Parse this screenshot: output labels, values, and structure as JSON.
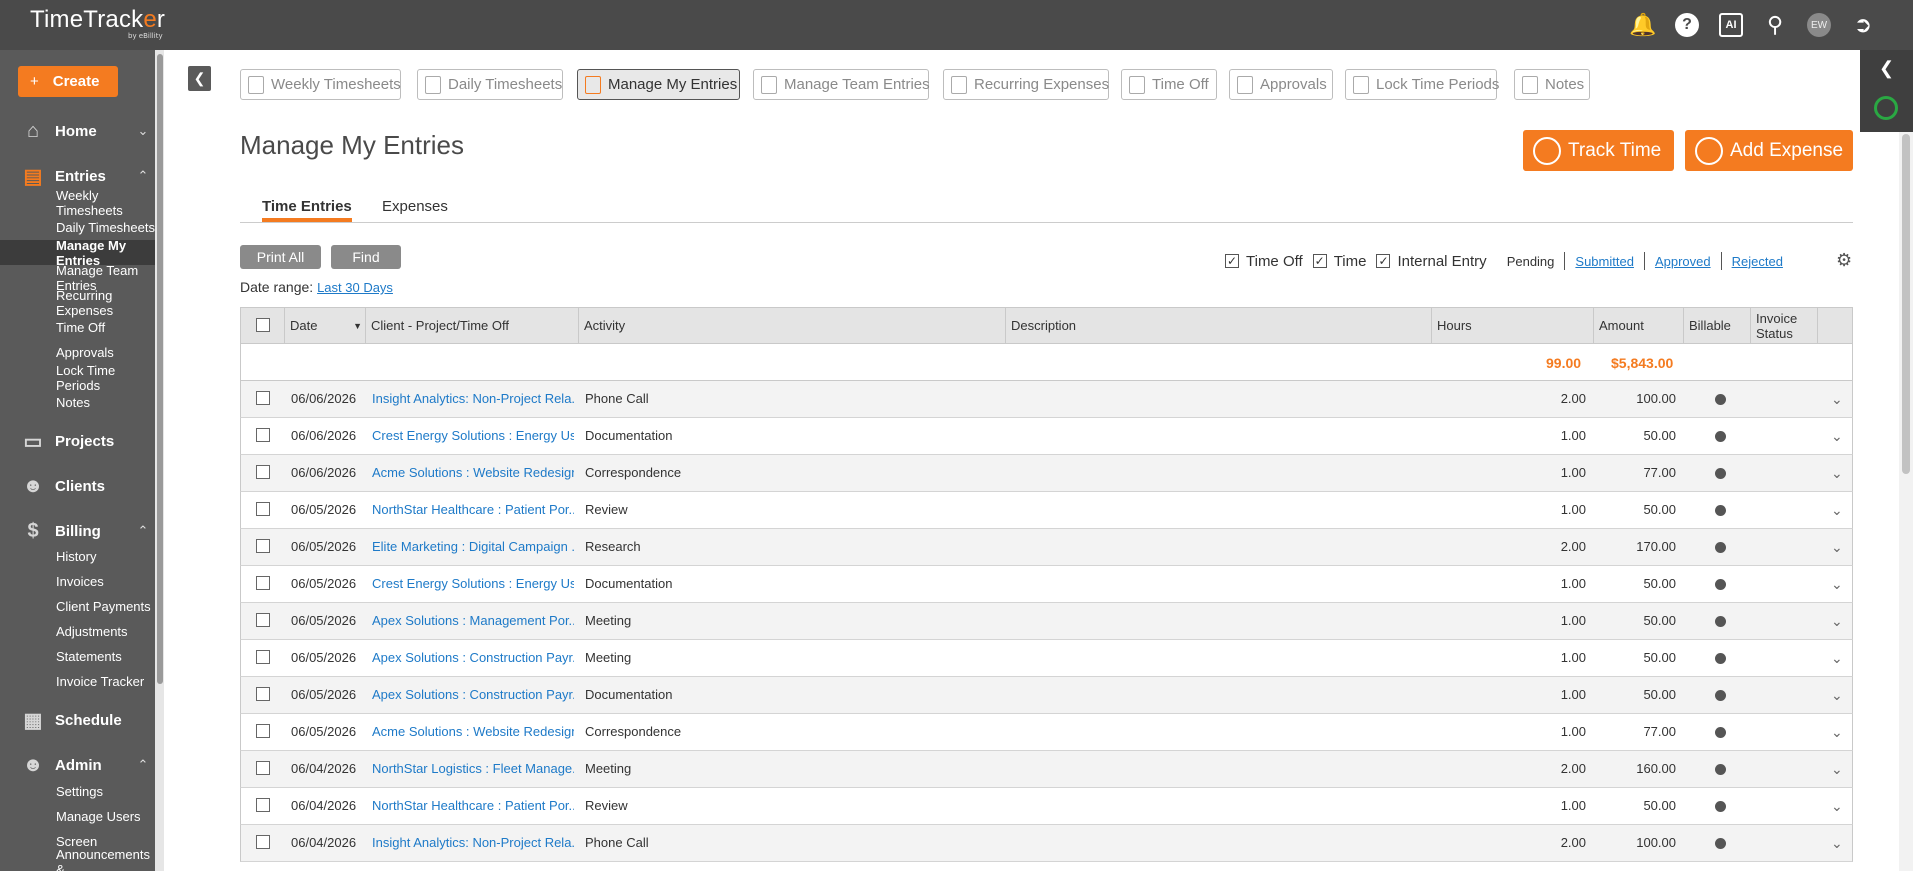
{
  "app": {
    "logo_text_a": "TimeTrack",
    "logo_text_o": "e",
    "logo_text_b": "r",
    "logo_sub": "by eBillity",
    "avatar_initials": "EW",
    "ai_label": "AI"
  },
  "sidebar": {
    "create_label": "Create",
    "sections": [
      {
        "label": "Home",
        "icon": "home-icon"
      },
      {
        "label": "Entries",
        "icon": "entries-icon",
        "items": [
          "Weekly Timesheets",
          "Daily Timesheets",
          "Manage My Entries",
          "Manage Team Entries",
          "Recurring Expenses",
          "Time Off",
          "Approvals",
          "Lock Time Periods",
          "Notes"
        ]
      },
      {
        "label": "Projects",
        "icon": "projects-icon"
      },
      {
        "label": "Clients",
        "icon": "clients-icon"
      },
      {
        "label": "Billing",
        "icon": "billing-icon",
        "items": [
          "History",
          "Invoices",
          "Client Payments",
          "Adjustments",
          "Statements",
          "Invoice Tracker"
        ]
      },
      {
        "label": "Schedule",
        "icon": "schedule-icon"
      },
      {
        "label": "Admin",
        "icon": "admin-icon",
        "items": [
          "Settings",
          "Manage Users",
          "Screen",
          "Announcements &"
        ]
      }
    ]
  },
  "toolbar": {
    "tabs": [
      "Weekly Timesheets",
      "Daily Timesheets",
      "Manage My Entries",
      "Manage Team Entries",
      "Recurring Expenses",
      "Time Off",
      "Approvals",
      "Lock Time Periods",
      "Notes"
    ],
    "active": "Manage My Entries"
  },
  "page": {
    "title": "Manage My Entries",
    "track_time": "Track Time",
    "add_expense": "Add Expense",
    "subtabs": [
      "Time Entries",
      "Expenses"
    ],
    "print_all": "Print All",
    "find": "Find",
    "date_range_label": "Date range:",
    "date_range_value": "Last 30 Days"
  },
  "filters": {
    "checkboxes": [
      "Time Off",
      "Time",
      "Internal Entry"
    ],
    "statuses": [
      "Pending",
      "Submitted",
      "Approved",
      "Rejected"
    ]
  },
  "table": {
    "headers": [
      "Date",
      "Client - Project/Time Off",
      "Activity",
      "Description",
      "Hours",
      "Amount",
      "Billable",
      "Invoice Status"
    ],
    "total_hours": "99.00",
    "total_amount": "$5,843.00",
    "rows": [
      {
        "date": "06/06/2026",
        "client": "Insight Analytics: Non-Project Rela...",
        "activity": "Phone Call",
        "hours": "2.00",
        "amount": "100.00"
      },
      {
        "date": "06/06/2026",
        "client": "Crest Energy Solutions : Energy Us...",
        "activity": "Documentation",
        "hours": "1.00",
        "amount": "50.00"
      },
      {
        "date": "06/06/2026",
        "client": "Acme Solutions : Website Redesign",
        "activity": "Correspondence",
        "hours": "1.00",
        "amount": "77.00"
      },
      {
        "date": "06/05/2026",
        "client": "NorthStar Healthcare : Patient Por...",
        "activity": "Review",
        "hours": "1.00",
        "amount": "50.00"
      },
      {
        "date": "06/05/2026",
        "client": "Elite Marketing : Digital Campaign ...",
        "activity": "Research",
        "hours": "2.00",
        "amount": "170.00"
      },
      {
        "date": "06/05/2026",
        "client": "Crest Energy Solutions : Energy Us...",
        "activity": "Documentation",
        "hours": "1.00",
        "amount": "50.00"
      },
      {
        "date": "06/05/2026",
        "client": "Apex Solutions : Management Por...",
        "activity": "Meeting",
        "hours": "1.00",
        "amount": "50.00"
      },
      {
        "date": "06/05/2026",
        "client": "Apex Solutions : Construction Payr...",
        "activity": "Meeting",
        "hours": "1.00",
        "amount": "50.00"
      },
      {
        "date": "06/05/2026",
        "client": "Apex Solutions : Construction Payr...",
        "activity": "Documentation",
        "hours": "1.00",
        "amount": "50.00"
      },
      {
        "date": "06/05/2026",
        "client": "Acme Solutions : Website Redesign",
        "activity": "Correspondence",
        "hours": "1.00",
        "amount": "77.00"
      },
      {
        "date": "06/04/2026",
        "client": "NorthStar Logistics : Fleet Manage...",
        "activity": "Meeting",
        "hours": "2.00",
        "amount": "160.00"
      },
      {
        "date": "06/04/2026",
        "client": "NorthStar Healthcare : Patient Por...",
        "activity": "Review",
        "hours": "1.00",
        "amount": "50.00"
      },
      {
        "date": "06/04/2026",
        "client": "Insight Analytics: Non-Project Rela...",
        "activity": "Phone Call",
        "hours": "2.00",
        "amount": "100.00"
      }
    ]
  }
}
